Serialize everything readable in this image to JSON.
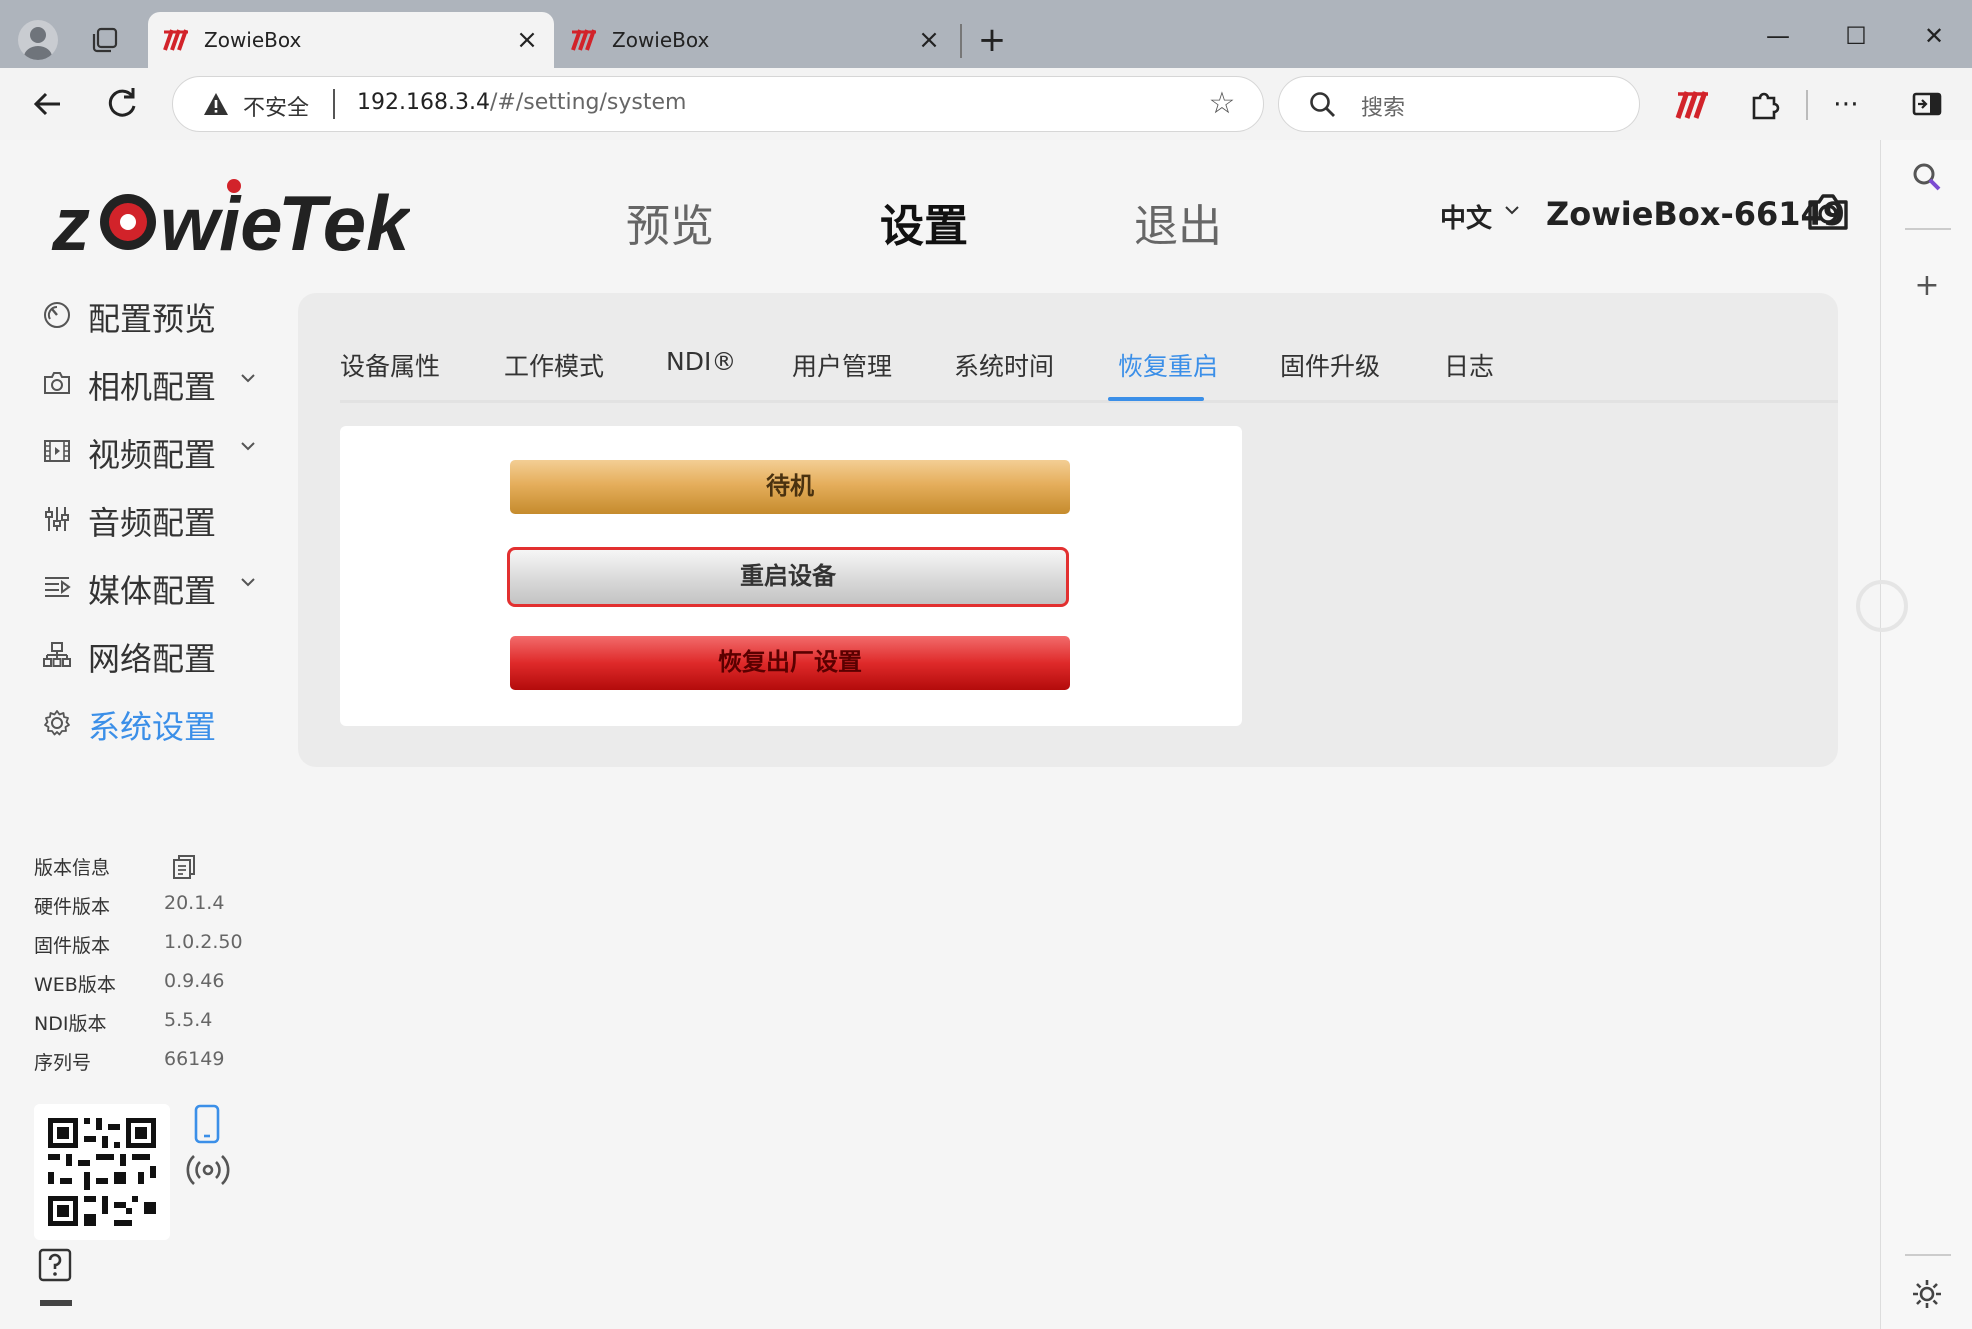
{
  "browser": {
    "tabs": [
      {
        "title": "ZowieBox",
        "active": true
      },
      {
        "title": "ZowieBox",
        "active": false
      }
    ],
    "close_glyph": "×",
    "new_tab_glyph": "+",
    "window": {
      "minimize": "—",
      "maximize": "☐",
      "close": "✕"
    },
    "security_label": "不安全",
    "url_host": "192.168.3.4",
    "url_path": "/#/setting/system",
    "search_placeholder": "搜索"
  },
  "header": {
    "logo_text": "zowieTek",
    "nav": [
      {
        "label": "预览",
        "active": false
      },
      {
        "label": "设置",
        "active": true
      },
      {
        "label": "退出",
        "active": false
      }
    ],
    "language": "中文",
    "device_name": "ZowieBox-66149"
  },
  "sidebar": {
    "items": [
      {
        "label": "配置预览",
        "icon": "gauge-icon",
        "expandable": false,
        "active": false
      },
      {
        "label": "相机配置",
        "icon": "camera-icon",
        "expandable": true,
        "active": false
      },
      {
        "label": "视频配置",
        "icon": "film-icon",
        "expandable": true,
        "active": false
      },
      {
        "label": "音频配置",
        "icon": "mixer-icon",
        "expandable": false,
        "active": false
      },
      {
        "label": "媒体配置",
        "icon": "media-icon",
        "expandable": true,
        "active": false
      },
      {
        "label": "网络配置",
        "icon": "network-icon",
        "expandable": false,
        "active": false
      },
      {
        "label": "系统设置",
        "icon": "gear-icon",
        "expandable": false,
        "active": true
      }
    ]
  },
  "subtabs": [
    {
      "label": "设备属性",
      "active": false
    },
    {
      "label": "工作模式",
      "active": false
    },
    {
      "label": "NDI®",
      "active": false
    },
    {
      "label": "用户管理",
      "active": false
    },
    {
      "label": "系统时间",
      "active": false
    },
    {
      "label": "恢复重启",
      "active": true
    },
    {
      "label": "固件升级",
      "active": false
    },
    {
      "label": "日志",
      "active": false
    }
  ],
  "actions": {
    "standby": "待机",
    "reboot": "重启设备",
    "factory_reset": "恢复出厂设置"
  },
  "version_info": {
    "title": "版本信息",
    "rows": [
      {
        "key": "硬件版本",
        "value": "20.1.4"
      },
      {
        "key": "固件版本",
        "value": "1.0.2.50"
      },
      {
        "key": "WEB版本",
        "value": "0.9.46"
      },
      {
        "key": "NDI版本",
        "value": "5.5.4"
      },
      {
        "key": "序列号",
        "value": "66149"
      }
    ]
  },
  "colors": {
    "accent": "#3b8fe8",
    "brand_red": "#d2232a",
    "standby_gold": "#e5ae5c",
    "reset_red": "#df2a2a",
    "highlight_outline": "#e23030"
  }
}
